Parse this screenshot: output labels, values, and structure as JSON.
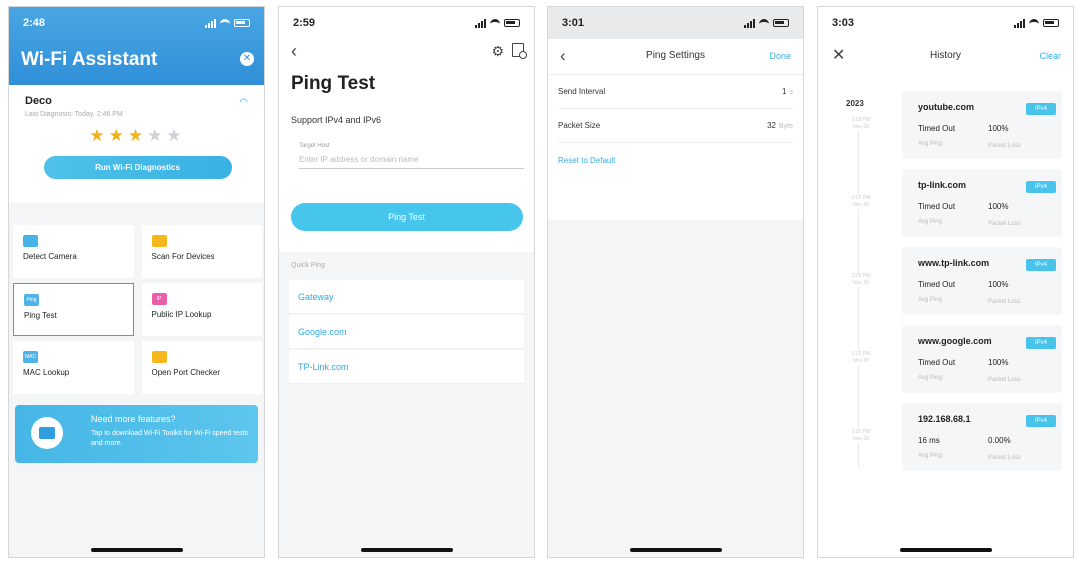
{
  "panel1": {
    "time": "2:48",
    "title": "Wi-Fi Assistant",
    "close_glyph": "✕",
    "device_name": "Deco",
    "last_diagnosis": "Last Diagnosis: Today, 2:46 PM",
    "rating_filled": 3,
    "rating_total": 5,
    "run_button": "Run Wi-Fi Diagnostics",
    "tools": [
      {
        "label": "Detect Camera",
        "icon": "camera-icon",
        "color": "#46b3e6",
        "icon_text": ""
      },
      {
        "label": "Scan For Devices",
        "icon": "folder-icon",
        "color": "#f5b81c",
        "icon_text": ""
      },
      {
        "label": "Ping Test",
        "icon": "ping-icon",
        "color": "#4eb4e8",
        "icon_text": "Ping"
      },
      {
        "label": "Public IP Lookup",
        "icon": "ip-icon",
        "color": "#e85fa8",
        "icon_text": "IP"
      },
      {
        "label": "MAC Lookup",
        "icon": "mac-icon",
        "color": "#4eb4e8",
        "icon_text": "MAC"
      },
      {
        "label": "Open Port Checker",
        "icon": "port-icon",
        "color": "#f5b81c",
        "icon_text": ""
      }
    ],
    "selected_tool": "Ping Test",
    "banner_title": "Need more features?",
    "banner_text": "Tap to download Wi-Fi Toolkit for Wi-Fi speed tests and more."
  },
  "panel2": {
    "time": "2:59",
    "title": "Ping Test",
    "support": "Support IPv4 and IPv6",
    "target_label": "Target Host",
    "target_placeholder": "Enter IP address or domain name",
    "ping_button": "Ping Test",
    "quick_ping_label": "Quick Ping",
    "quick_ping": [
      "Gateway",
      "Google.com",
      "TP-Link.com"
    ]
  },
  "panel3": {
    "time": "3:01",
    "title": "Ping Settings",
    "done": "Done",
    "rows": [
      {
        "label": "Send Interval",
        "value": "1",
        "unit": "s"
      },
      {
        "label": "Packet Size",
        "value": "32",
        "unit": "Byte"
      }
    ],
    "reset": "Reset to Default"
  },
  "panel4": {
    "time": "3:03",
    "title": "History",
    "clear": "Clear",
    "year": "2023",
    "entries": [
      {
        "host": "youtube.com",
        "badge": "IPv4",
        "avg": "Timed Out",
        "loss": "100%",
        "avg_label": "Avg Ping",
        "loss_label": "Packet Loss",
        "time": "3:03 PM",
        "date": "Nov 30"
      },
      {
        "host": "tp-link.com",
        "badge": "IPv4",
        "avg": "Timed Out",
        "loss": "100%",
        "avg_label": "Avg Ping",
        "loss_label": "Packet Loss",
        "time": "3:02 PM",
        "date": "Nov 30"
      },
      {
        "host": "www.tp-link.com",
        "badge": "IPv4",
        "avg": "Timed Out",
        "loss": "100%",
        "avg_label": "Avg Ping",
        "loss_label": "Packet Loss",
        "time": "3:02 PM",
        "date": "Nov 30"
      },
      {
        "host": "www.google.com",
        "badge": "IPv4",
        "avg": "Timed Out",
        "loss": "100%",
        "avg_label": "Avg Ping",
        "loss_label": "Packet Loss",
        "time": "3:01 PM",
        "date": "Nov 30"
      },
      {
        "host": "192.168.68.1",
        "badge": "IPv4",
        "avg": "16 ms",
        "loss": "0.00%",
        "avg_label": "Avg Ping",
        "loss_label": "Packet Loss",
        "time": "3:01 PM",
        "date": "Nov 30"
      }
    ]
  },
  "colors": {
    "accent": "#36b0e6",
    "star": "#f2b21c",
    "selected_border": "#e8646b"
  }
}
